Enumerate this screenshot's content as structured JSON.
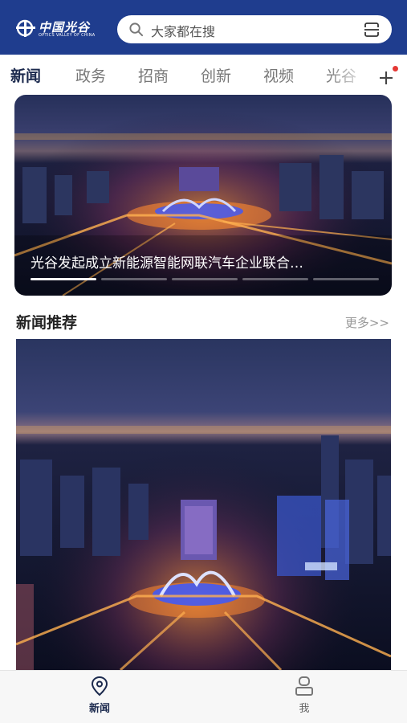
{
  "header": {
    "logo_text": "中国光谷",
    "logo_subtitle": "OPTICS VALLEY OF CHINA",
    "search_placeholder": "大家都在搜",
    "colors": {
      "bar": "#1f3d8e"
    }
  },
  "tabs": [
    {
      "label": "新闻",
      "active": true
    },
    {
      "label": "政务",
      "active": false
    },
    {
      "label": "招商",
      "active": false
    },
    {
      "label": "创新",
      "active": false
    },
    {
      "label": "视频",
      "active": false
    },
    {
      "label": "光谷",
      "active": false
    }
  ],
  "tab_add": {
    "icon": "plus-icon",
    "has_notification": true,
    "notification_color": "#e53935"
  },
  "banner": {
    "caption": "光谷发起成立新能源智能网联汽车企业联合…",
    "slide_count": 5,
    "active_slide": 1
  },
  "section": {
    "title": "新闻推荐",
    "more_label": "更多>>"
  },
  "bottom_nav": [
    {
      "label": "新闻",
      "icon": "location-pin-icon",
      "active": true
    },
    {
      "label": "我",
      "icon": "person-icon",
      "active": false
    }
  ],
  "colors": {
    "accent": "#1f3d8e",
    "active_text": "#1c2a4e",
    "inactive_text": "#777777"
  }
}
